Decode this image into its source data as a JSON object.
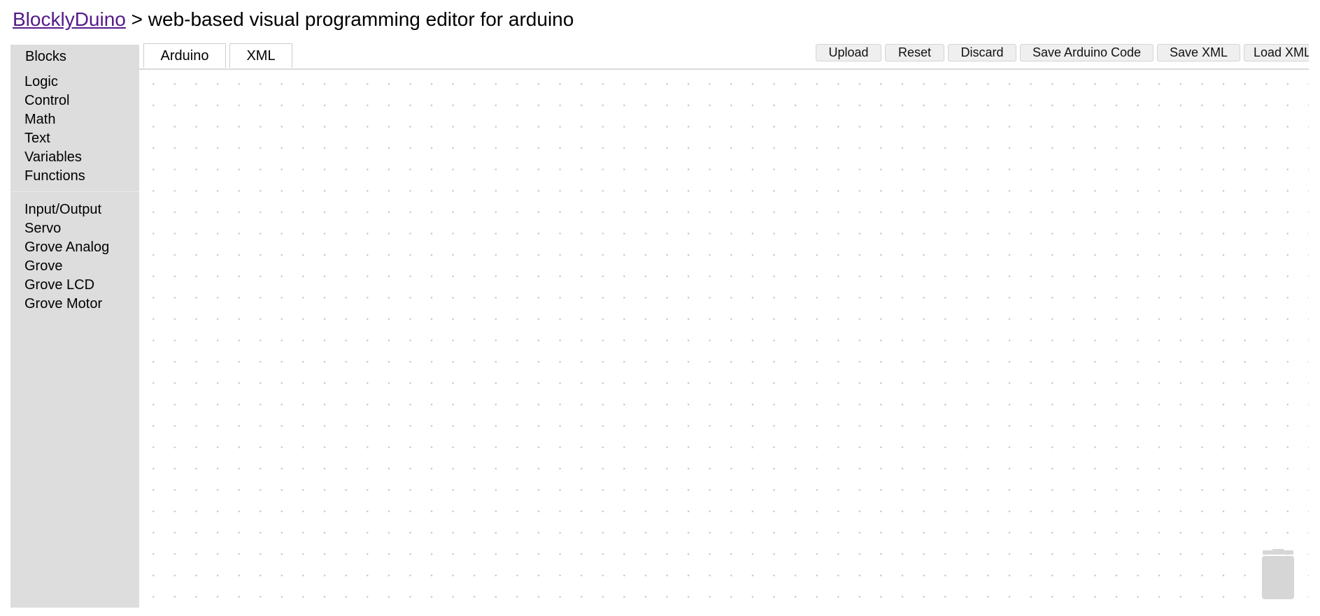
{
  "header": {
    "link_text": "BlocklyDuino",
    "subtitle": " > web-based visual programming editor for arduino"
  },
  "sidebar": {
    "title": "Blocks",
    "groups": [
      [
        "Logic",
        "Control",
        "Math",
        "Text",
        "Variables",
        "Functions"
      ],
      [
        "Input/Output",
        "Servo",
        "Grove Analog",
        "Grove",
        "Grove LCD",
        "Grove Motor"
      ]
    ]
  },
  "tabs": [
    {
      "label": "Arduino",
      "selected": true
    },
    {
      "label": "XML",
      "selected": false
    }
  ],
  "toolbar": {
    "upload": "Upload",
    "reset": "Reset",
    "discard": "Discard",
    "save_code": "Save Arduino Code",
    "save_xml": "Save XML",
    "load_xml": "Load XML"
  },
  "icons": {
    "trash": "trash-icon"
  },
  "colors": {
    "sidebar_bg": "#dddddd",
    "link": "#551a8b",
    "grid_dot": "#c9c9c9",
    "trash": "#d6d6d6"
  }
}
